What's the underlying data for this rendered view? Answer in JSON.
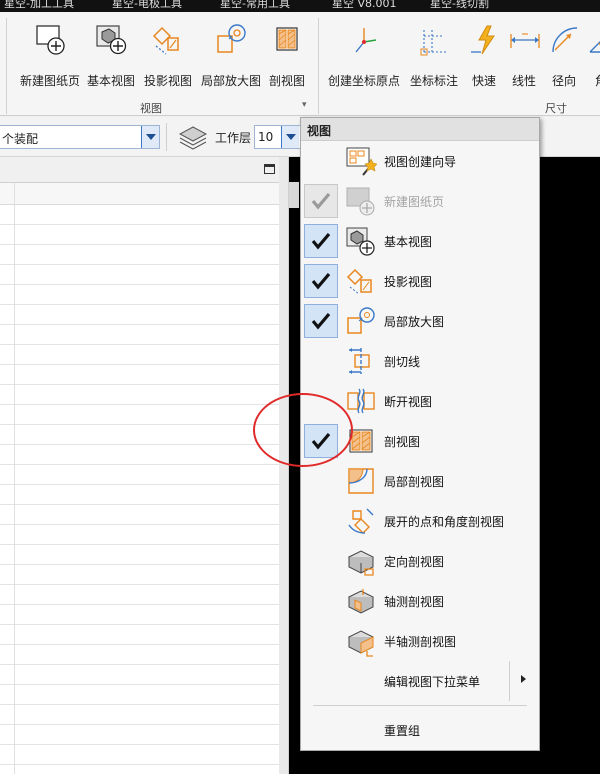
{
  "title_tabs": [
    "星空-加工工具",
    "星空-电极工具",
    "星空-常用工具",
    "星空 V8.001",
    "星空-线切割"
  ],
  "ribbon": {
    "view_group_label": "视图",
    "dimension_group_label": "尺寸",
    "view_buttons": [
      {
        "label": "新建图纸页",
        "icon": "new-sheet-icon"
      },
      {
        "label": "基本视图",
        "icon": "base-view-icon"
      },
      {
        "label": "投影视图",
        "icon": "projected-view-icon"
      },
      {
        "label": "局部放大图",
        "icon": "detail-view-icon"
      },
      {
        "label": "剖视图",
        "icon": "section-view-icon"
      }
    ],
    "dim_buttons": [
      {
        "label": "创建坐标原点",
        "icon": "coordinate-origin-icon"
      },
      {
        "label": "坐标标注",
        "icon": "ordinate-dimension-icon"
      },
      {
        "label": "快速",
        "icon": "rapid-dimension-icon"
      },
      {
        "label": "线性",
        "icon": "linear-dimension-icon"
      },
      {
        "label": "径向",
        "icon": "radial-dimension-icon"
      },
      {
        "label": "角",
        "icon": "angular-dimension-icon"
      }
    ]
  },
  "toolbar": {
    "assembly_combo": "个装配",
    "layer_label": "工作层",
    "layer_value": "10"
  },
  "menu": {
    "title": "视图",
    "items": [
      {
        "label": "视图创建向导",
        "checked": false,
        "disabled": false,
        "icon": "view-wizard-icon"
      },
      {
        "label": "新建图纸页",
        "checked": true,
        "disabled": true,
        "icon": "new-sheet-icon"
      },
      {
        "label": "基本视图",
        "checked": true,
        "disabled": false,
        "icon": "base-view-icon"
      },
      {
        "label": "投影视图",
        "checked": true,
        "disabled": false,
        "icon": "projected-view-icon"
      },
      {
        "label": "局部放大图",
        "checked": true,
        "disabled": false,
        "icon": "detail-view-icon"
      },
      {
        "label": "剖切线",
        "checked": false,
        "disabled": false,
        "icon": "section-line-icon"
      },
      {
        "label": "断开视图",
        "checked": false,
        "disabled": false,
        "icon": "broken-view-icon"
      },
      {
        "label": "剖视图",
        "checked": true,
        "disabled": false,
        "icon": "section-view-icon"
      },
      {
        "label": "局部剖视图",
        "checked": false,
        "disabled": false,
        "icon": "break-out-section-icon"
      },
      {
        "label": "展开的点和角度剖视图",
        "checked": false,
        "disabled": false,
        "icon": "unfolded-section-icon"
      },
      {
        "label": "定向剖视图",
        "checked": false,
        "disabled": false,
        "icon": "oriented-section-icon"
      },
      {
        "label": "轴测剖视图",
        "checked": false,
        "disabled": false,
        "icon": "pictorial-section-icon"
      },
      {
        "label": "半轴测剖视图",
        "checked": false,
        "disabled": false,
        "icon": "half-pictorial-section-icon"
      }
    ],
    "submenu_label": "编辑视图下拉菜单",
    "reset_label": "重置组"
  },
  "colors": {
    "accent": "#3a78c8",
    "orange": "#e8871e",
    "highlight": "#e12a2a"
  }
}
